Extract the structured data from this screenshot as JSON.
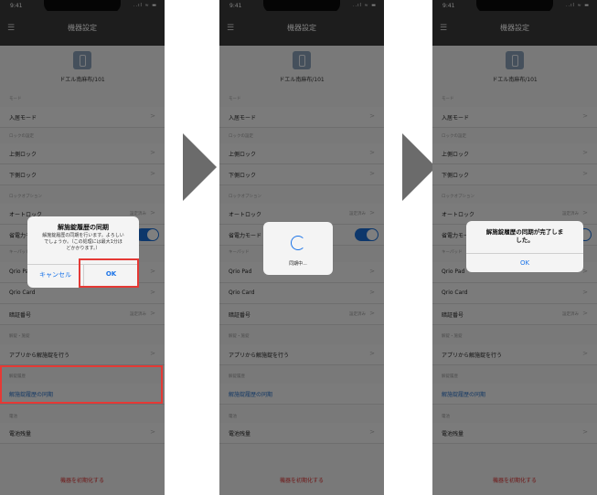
{
  "status_time": "9:41",
  "status_icons": "..ıl ≈ ▬",
  "nav_title": "機器設定",
  "device_name": "ドエル南麻布/101",
  "sections": {
    "mode": "モード",
    "lock_settings": "ロックの設定",
    "lock_options": "ロックオプション",
    "keypad": "キーパッド",
    "unlock_lock": "解錠・施錠",
    "history": "解錠履歴",
    "battery": "電池"
  },
  "rows": {
    "entry_mode": "入居モード",
    "upper_lock": "上側ロック",
    "lower_lock": "下側ロック",
    "auto_lock": "オートロック",
    "power_save_mode": "省電力モード",
    "qrio_pad": "Qrio Pad",
    "qrio_card": "Qrio Card",
    "pin_number": "暗証番号",
    "app_unlock": "アプリから解施錠を行う",
    "history_sync": "解施錠履歴の同期",
    "battery_level": "電池残量"
  },
  "row_status": "設定済み",
  "chevron": ">",
  "reset_label": "機器を初期化する",
  "dialog_confirm": {
    "title": "解施錠履歴の同期",
    "message_1": "解施錠履歴の同期を行います。よろしい",
    "message_2": "でしょうか。（この処理には最大1分ほ",
    "message_3": "どかかります。）",
    "cancel": "キャンセル",
    "ok": "OK"
  },
  "dialog_loading": {
    "text": "同期中..."
  },
  "dialog_done": {
    "title_1": "解施錠履歴の同期が完了しま",
    "title_2": "した。",
    "ok": "OK"
  },
  "colors": {
    "highlight": "#e53935",
    "accent": "#1a73e8",
    "arrow": "#6b6b6b",
    "navbar": "#3b3b3b"
  }
}
